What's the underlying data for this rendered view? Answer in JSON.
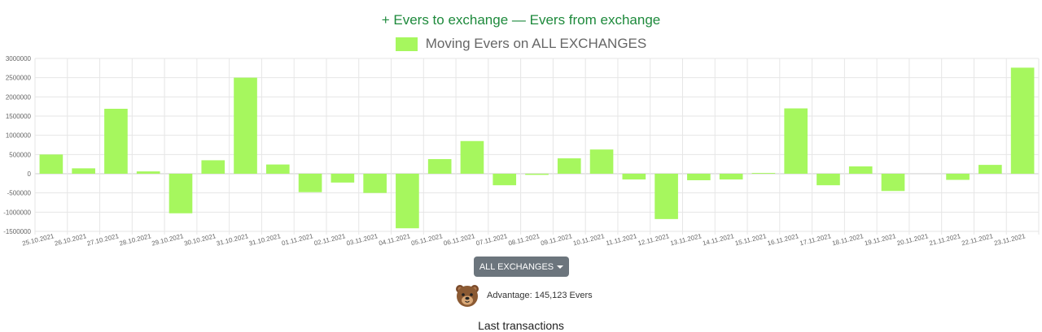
{
  "header": {
    "title": "+ Evers to exchange — Evers from exchange"
  },
  "chart_data": {
    "type": "bar",
    "title": "+ Evers to exchange — Evers from exchange",
    "legend": [
      {
        "label": "Moving Evers on ALL EXCHANGES",
        "color": "#a6f75e"
      }
    ],
    "legend_position": "top",
    "grid": true,
    "ylim": [
      -1500000,
      3000000
    ],
    "yticks": [
      3000000,
      2500000,
      2000000,
      1500000,
      1000000,
      500000,
      0,
      -500000,
      -1000000,
      -1500000
    ],
    "ytick_labels": [
      "3000000",
      "2500000",
      "2000000",
      "1500000",
      "1000000",
      "500000",
      "0",
      "-500000",
      "-1000000",
      "-1500000"
    ],
    "categories": [
      "25.10.2021",
      "26.10.2021",
      "27.10.2021",
      "28.10.2021",
      "29.10.2021",
      "30.10.2021",
      "31.10.2021",
      "31.10.2021",
      "01.11.2021",
      "02.11.2021",
      "03.11.2021",
      "04.11.2021",
      "05.11.2021",
      "06.11.2021",
      "07.11.2021",
      "08.11.2021",
      "09.11.2021",
      "10.11.2021",
      "11.11.2021",
      "12.11.2021",
      "13.11.2021",
      "14.11.2021",
      "15.11.2021",
      "16.11.2021",
      "17.11.2021",
      "18.11.2021",
      "19.11.2021",
      "20.11.2021",
      "21.11.2021",
      "22.11.2021",
      "23.11.2021"
    ],
    "series": [
      {
        "name": "Moving Evers on ALL EXCHANGES",
        "color": "#a6f75e",
        "values": [
          500000,
          140000,
          1690000,
          60000,
          -1030000,
          350000,
          2500000,
          240000,
          -480000,
          -230000,
          -500000,
          -1420000,
          380000,
          850000,
          -300000,
          -30000,
          400000,
          630000,
          -150000,
          -1180000,
          -170000,
          -150000,
          20000,
          1700000,
          -300000,
          190000,
          -450000,
          0,
          -160000,
          230000,
          2760000
        ]
      }
    ]
  },
  "controls": {
    "exchange_dropdown_label": "ALL EXCHANGES"
  },
  "advantage": {
    "icon": "bear-icon",
    "text": "Advantage: 145,123 Evers"
  },
  "footer": {
    "partial_text": "Last transactions"
  }
}
